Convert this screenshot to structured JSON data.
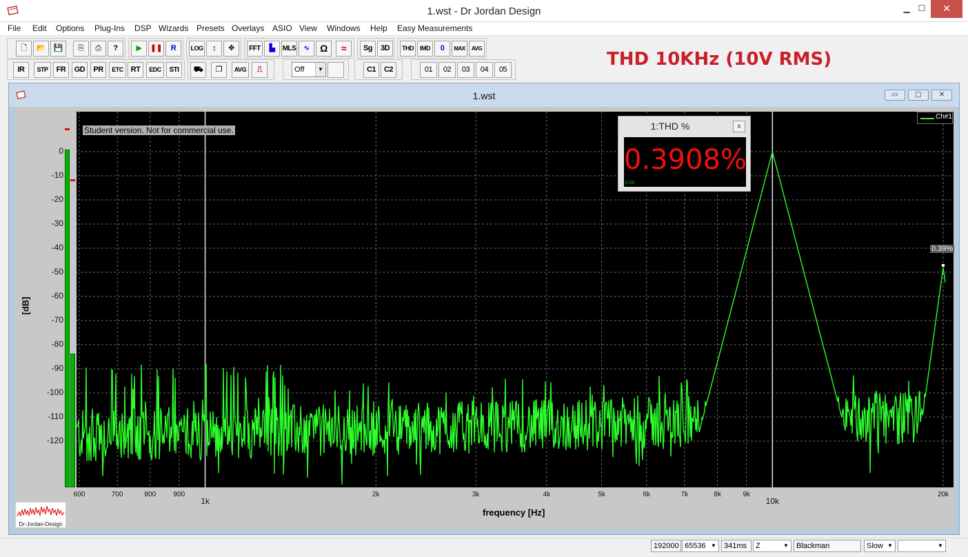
{
  "window": {
    "title": "1.wst - Dr Jordan Design",
    "min_glyph": "▁",
    "max_glyph": "☐",
    "close_glyph": "✕"
  },
  "menu": [
    "File",
    "Edit",
    "Options",
    "Plug-Ins",
    "DSP",
    "Wizards",
    "Presets",
    "Overlays",
    "ASIO",
    "View",
    "Windows",
    "Help",
    "Easy Measurements"
  ],
  "toolbar": {
    "row1": {
      "new": "🗋",
      "open": "📂",
      "save": "💾",
      "copy": "⎘",
      "print": "⎙",
      "help": "?",
      "play": "▶",
      "pause": "❚❚",
      "record": "R",
      "log": "LOG",
      "vzoom": "↕",
      "pan": "✥",
      "fft": "FFT",
      "bars": "▙",
      "mls": "MLS",
      "sweep": "∿",
      "ohm": "Ω",
      "wave": "≈",
      "sg": "Sg",
      "3d": "3D",
      "thd": "THD",
      "imd": "IMD",
      "zero": "0",
      "max": "MAX",
      "avg": "AVG"
    },
    "row2": {
      "ir": "IR",
      "stp": "STP",
      "fr": "FR",
      "gd": "GD",
      "pr": "PR",
      "etc": "ETC",
      "rt": "RT",
      "edc": "EDC",
      "sti": "STI",
      "tool1": "⛟",
      "tool2": "❐",
      "avg": "AVG",
      "tool3": "⎍",
      "off_select": "Off",
      "c1": "C1",
      "c2": "C2",
      "presets": [
        "01",
        "02",
        "03",
        "04",
        "05"
      ]
    }
  },
  "annotation": "THD 10KHz (10V RMS)",
  "child_window": {
    "title": "1.wst",
    "min_glyph": "▭",
    "max_glyph": "▢",
    "close_glyph": "✕"
  },
  "plot": {
    "watermark": "Student version. Not for commercial use.",
    "legend": "Ch#1",
    "marker_label": "0.39%",
    "ylabel": "[dB]",
    "xlabel": "frequency [Hz]",
    "meter_level_db": 0,
    "colors": {
      "trace": "#2cff2c",
      "background": "#000000",
      "grid": "#8a8a8a",
      "meter": "#00b400"
    }
  },
  "thd_meter": {
    "title": "1:THD %",
    "value": "0.3908%",
    "min_label": "0.00",
    "max_label": "--",
    "close_glyph": "x"
  },
  "logo_text": "Dr-Jordan-Design",
  "status": {
    "sample_rate": "192000",
    "fft_size": "65536",
    "duration": "341ms",
    "weighting": "Z",
    "window": "Blackman",
    "speed": "Slow",
    "extra": ""
  },
  "chart_data": {
    "type": "line",
    "title": "",
    "xlabel": "frequency [Hz]",
    "ylabel": "[dB]",
    "x_scale": "log",
    "xlim": [
      590,
      21000
    ],
    "ylim": [
      -140,
      2
    ],
    "grid": true,
    "legend_position": "top-right",
    "x_ticks": [
      600,
      700,
      800,
      900,
      1000,
      2000,
      3000,
      4000,
      5000,
      6000,
      7000,
      8000,
      9000,
      10000,
      20000
    ],
    "x_tick_labels": [
      "600",
      "700",
      "800",
      "900",
      "1k",
      "2k",
      "3k",
      "4k",
      "5k",
      "6k",
      "7k",
      "8k",
      "9k",
      "10k",
      "20k"
    ],
    "y_ticks": [
      0,
      -10,
      -20,
      -30,
      -40,
      -50,
      -60,
      -70,
      -80,
      -90,
      -100,
      -110,
      -120
    ],
    "series": [
      {
        "name": "Ch#1",
        "peaks": [
          {
            "x": 10000,
            "y": 0
          },
          {
            "x": 20000,
            "y": -48
          }
        ],
        "noise_floor_db": -112
      }
    ],
    "annotations": [
      {
        "x": 20000,
        "y": -48,
        "text": "0.39%"
      }
    ]
  }
}
